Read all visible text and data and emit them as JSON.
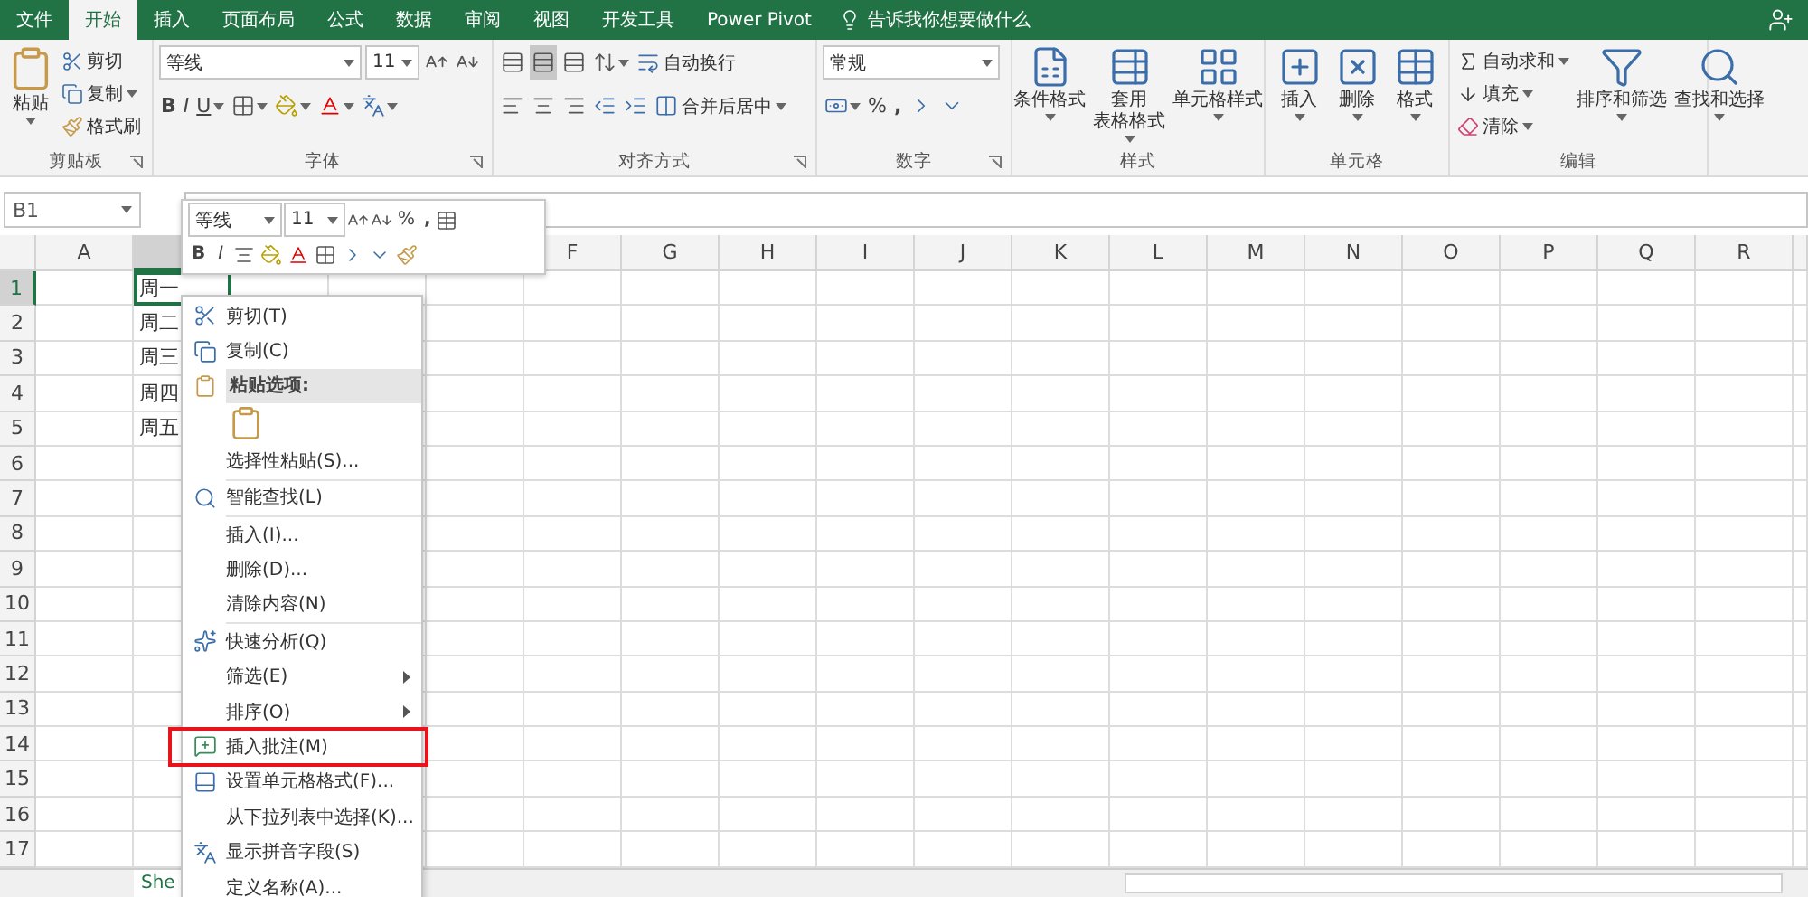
{
  "tabs": [
    {
      "label": "文件",
      "selected": false
    },
    {
      "label": "开始",
      "selected": true
    },
    {
      "label": "插入",
      "selected": false
    },
    {
      "label": "页面布局",
      "selected": false
    },
    {
      "label": "公式",
      "selected": false
    },
    {
      "label": "数据",
      "selected": false
    },
    {
      "label": "审阅",
      "selected": false
    },
    {
      "label": "视图",
      "selected": false
    },
    {
      "label": "开发工具",
      "selected": false
    },
    {
      "label": "Power Pivot",
      "selected": false
    }
  ],
  "tell_me": "告诉我你想要做什么",
  "ribbon": {
    "groups": [
      {
        "kind": "clipboard",
        "label": "剪贴板",
        "paste": "粘贴",
        "cut": "剪切",
        "copy": "复制",
        "painter": "格式刷"
      },
      {
        "kind": "font",
        "label": "字体",
        "font": "等线",
        "size": "11",
        "bold": "B",
        "italic": "I",
        "underline": "U"
      },
      {
        "kind": "alignment",
        "label": "对齐方式",
        "valign": [
          {
            "selected": false
          },
          {
            "selected": true
          },
          {
            "selected": false
          }
        ],
        "wrap": "自动换行",
        "merge": "合并后居中"
      },
      {
        "kind": "number",
        "label": "数字",
        "format": "常规",
        "percent": "%",
        "comma": ","
      },
      {
        "kind": "styles",
        "label": "样式",
        "buttons": [
          [
            "条件格式"
          ],
          [
            "套用",
            "表格格式"
          ],
          [
            "单元格样式"
          ]
        ]
      },
      {
        "kind": "cells",
        "label": "单元格",
        "buttons": [
          [
            "插入"
          ],
          [
            "删除"
          ],
          [
            "格式"
          ]
        ]
      },
      {
        "kind": "editing",
        "label": "编辑",
        "small": [
          "自动求和",
          "填充",
          "清除"
        ],
        "buttons": [
          [
            "排序和筛选"
          ],
          [
            "查找和选择"
          ]
        ]
      }
    ]
  },
  "name_box": "B1",
  "mini_toolbar": {
    "font": "等线",
    "size": "11",
    "percent": "%",
    "comma": ",",
    "bold": "B",
    "italic": "I"
  },
  "sheet": {
    "columns_left": [
      {
        "label": "A",
        "selected": false
      }
    ],
    "column_b_header": {
      "selected": true
    },
    "columns_right": [
      {
        "label": "F",
        "selected": false
      },
      {
        "label": "G",
        "selected": false
      },
      {
        "label": "H",
        "selected": false
      },
      {
        "label": "I",
        "selected": false
      },
      {
        "label": "J",
        "selected": false
      },
      {
        "label": "K",
        "selected": false
      },
      {
        "label": "L",
        "selected": false
      },
      {
        "label": "M",
        "selected": false
      },
      {
        "label": "N",
        "selected": false
      },
      {
        "label": "O",
        "selected": false
      },
      {
        "label": "P",
        "selected": false
      },
      {
        "label": "Q",
        "selected": false
      },
      {
        "label": "R",
        "selected": false
      }
    ],
    "rows": [
      {
        "label": "1",
        "selected": true,
        "column_b": "周一"
      },
      {
        "label": "2",
        "selected": false,
        "column_b": "周二"
      },
      {
        "label": "3",
        "selected": false,
        "column_b": "周三"
      },
      {
        "label": "4",
        "selected": false,
        "column_b": "周四"
      },
      {
        "label": "5",
        "selected": false,
        "column_b": "周五"
      },
      {
        "label": "6",
        "selected": false
      },
      {
        "label": "7",
        "selected": false
      },
      {
        "label": "8",
        "selected": false
      },
      {
        "label": "9",
        "selected": false
      },
      {
        "label": "10",
        "selected": false
      },
      {
        "label": "11",
        "selected": false
      },
      {
        "label": "12",
        "selected": false
      },
      {
        "label": "13",
        "selected": false
      },
      {
        "label": "14",
        "selected": false
      },
      {
        "label": "15",
        "selected": false
      },
      {
        "label": "16",
        "selected": false
      },
      {
        "label": "17",
        "selected": false
      }
    ]
  },
  "sheet_tab": "She",
  "context_menu": {
    "items": [
      {
        "kind": "item",
        "label": "剪切(T)",
        "highlighted": false
      },
      {
        "kind": "item",
        "label": "复制(C)",
        "highlighted": false
      },
      {
        "kind": "header",
        "label": "粘贴选项:"
      },
      {
        "kind": "paste-option"
      },
      {
        "kind": "item",
        "label": "选择性粘贴(S)...",
        "highlighted": false
      },
      {
        "kind": "separator"
      },
      {
        "kind": "item",
        "label": "智能查找(L)",
        "highlighted": false
      },
      {
        "kind": "separator"
      },
      {
        "kind": "item",
        "label": "插入(I)...",
        "highlighted": false
      },
      {
        "kind": "item",
        "label": "删除(D)...",
        "highlighted": false
      },
      {
        "kind": "item",
        "label": "清除内容(N)",
        "highlighted": false
      },
      {
        "kind": "separator"
      },
      {
        "kind": "item",
        "label": "快速分析(Q)",
        "highlighted": false
      },
      {
        "kind": "item",
        "label": "筛选(E)",
        "submenu": true,
        "highlighted": false
      },
      {
        "kind": "item",
        "label": "排序(O)",
        "submenu": true,
        "highlighted": false
      },
      {
        "kind": "item",
        "label": "插入批注(M)",
        "highlighted": true
      },
      {
        "kind": "item",
        "label": "设置单元格格式(F)...",
        "highlighted": false
      },
      {
        "kind": "item",
        "label": "从下拉列表中选择(K)...",
        "highlighted": false
      },
      {
        "kind": "item",
        "label": "显示拼音字段(S)",
        "highlighted": false
      },
      {
        "kind": "item",
        "label": "定义名称(A)...",
        "highlighted": false
      }
    ]
  }
}
